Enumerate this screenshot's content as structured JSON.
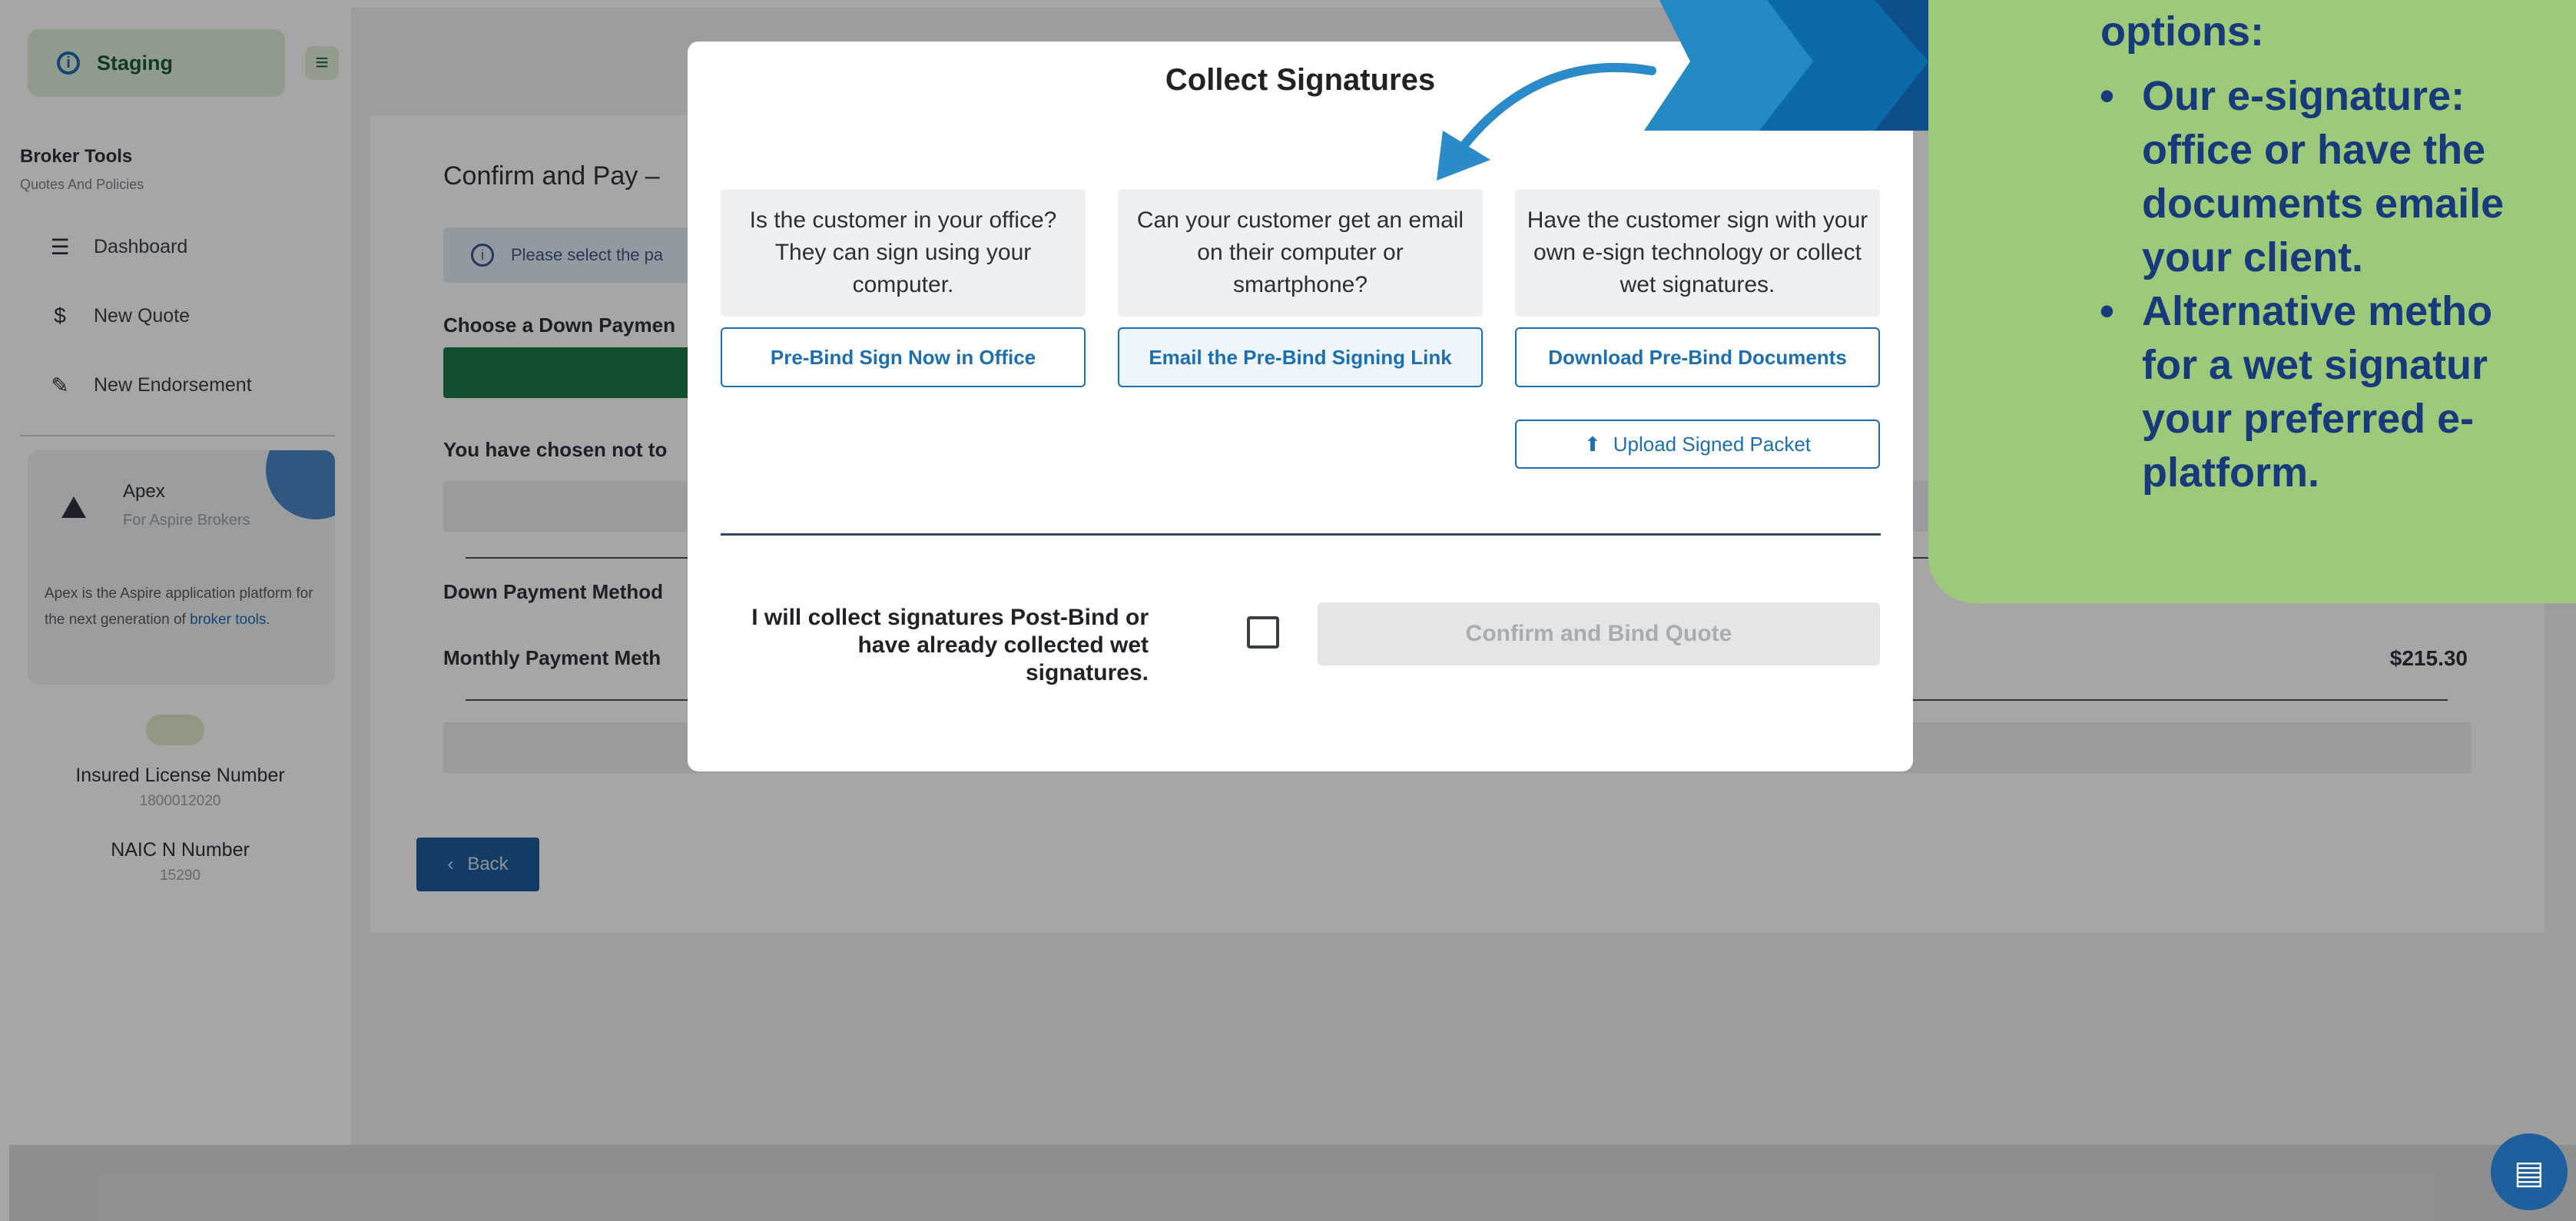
{
  "sidebar": {
    "env_label": "Staging",
    "broker_title": "Broker Tools",
    "broker_sub": "Quotes And Policies",
    "nav": [
      {
        "label": "Dashboard",
        "icon": "list-icon"
      },
      {
        "label": "New Quote",
        "icon": "dollar-icon"
      },
      {
        "label": "New Endorsement",
        "icon": "pencil-icon"
      }
    ],
    "apex": {
      "title": "Apex",
      "subtitle": "For Aspire Brokers",
      "desc_before": "Apex is the Aspire application platform for the next generation of ",
      "desc_link": "broker tools",
      "desc_after": "."
    },
    "insured_license_label": "Insured License Number",
    "insured_license_value": "1800012020",
    "naic_label": "NAIC N Number",
    "naic_value": "15290"
  },
  "main": {
    "title": "Confirm and Pay –",
    "notice": "Please select the pa",
    "choose_down_payment": "Choose a Down Paymen",
    "not_chosen": "You have chosen not to",
    "down_payment_method": "Down Payment Method",
    "monthly_payment_method": "Monthly Payment Meth",
    "monthly_amount": "$215.30",
    "back_label": "Back"
  },
  "modal": {
    "title": "Collect Signatures",
    "options": [
      {
        "description": "Is the customer in your office? They can sign using your computer.",
        "button": "Pre-Bind Sign Now in Office"
      },
      {
        "description": "Can your customer get an email on their computer or smartphone?",
        "button": "Email the Pre-Bind Signing Link"
      },
      {
        "description": "Have the customer sign with your own e-sign technology or collect wet signatures.",
        "button": "Download Pre-Bind Documents"
      }
    ],
    "upload_label": "Upload Signed Packet",
    "post_bind_line1": "I will collect signatures Post-Bind or",
    "post_bind_line2": "have already collected wet signatures.",
    "confirm_label": "Confirm and Bind Quote"
  },
  "callout": {
    "heading": "options:",
    "bullet1_lines": [
      " Our e-signature:",
      "office or have the",
      "documents emaile",
      "your client."
    ],
    "bullet2_lines": [
      "Alternative metho",
      "for a wet signatur",
      "your preferred e-",
      "platform."
    ]
  },
  "colors": {
    "accent": "#1e6fb0",
    "callout_bg": "#9dc97b",
    "callout_text": "#173a7a",
    "green": "#1d7a44"
  }
}
